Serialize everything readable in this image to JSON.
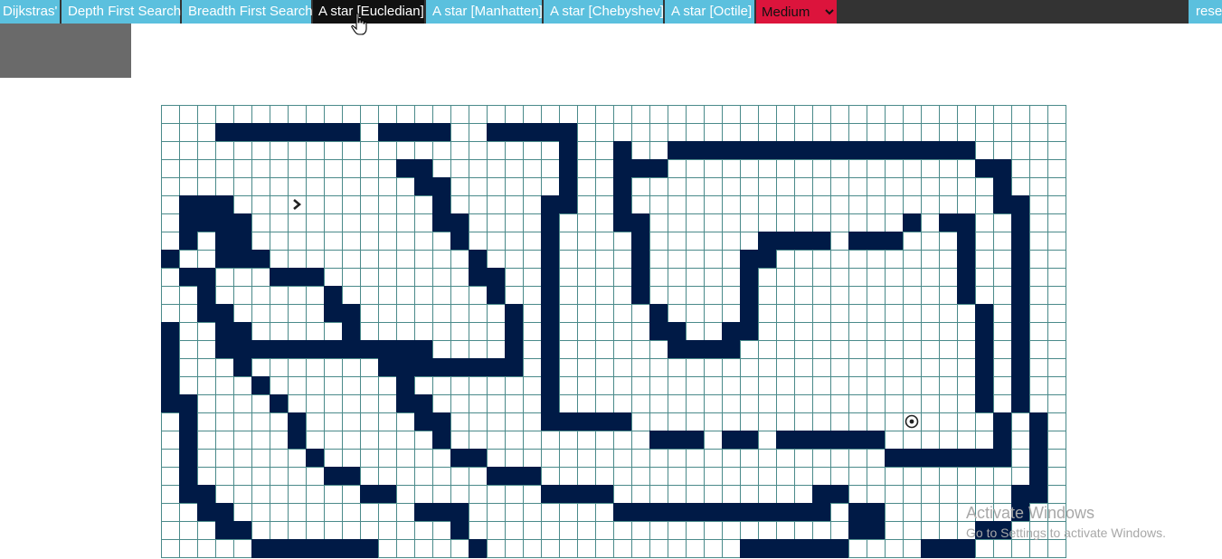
{
  "nav": {
    "buttons": [
      {
        "label": "Dijkstras'",
        "active": false
      },
      {
        "label": "Depth First Search",
        "active": false
      },
      {
        "label": "Breadth First Search",
        "active": false
      },
      {
        "label": "A star [Eucledian]",
        "active": true
      },
      {
        "label": "A star [Manhatten]",
        "active": false
      },
      {
        "label": "A star [Chebyshev]",
        "active": false
      },
      {
        "label": "A star [Octile]",
        "active": false
      }
    ],
    "speed": {
      "selected": "Medium",
      "options": [
        "Medium"
      ]
    },
    "reset_label": "reset"
  },
  "colors": {
    "navbar": "#333333",
    "button": "#5bc0de",
    "active_button": "#111111",
    "select": "#dc143c",
    "wall": "#001a46",
    "grid_line": "#4a8a8a",
    "panel": "#6a6a6a"
  },
  "grid": {
    "cols": 50,
    "rows": 25,
    "start": {
      "row": 5,
      "col": 7,
      "icon": "chevron-right-icon"
    },
    "target": {
      "row": 17,
      "col": 41,
      "icon": "target-icon"
    },
    "walls": [
      [
        1,
        3
      ],
      [
        1,
        4
      ],
      [
        1,
        5
      ],
      [
        1,
        6
      ],
      [
        1,
        7
      ],
      [
        1,
        8
      ],
      [
        1,
        9
      ],
      [
        1,
        10
      ],
      [
        1,
        12
      ],
      [
        1,
        13
      ],
      [
        1,
        14
      ],
      [
        1,
        15
      ],
      [
        1,
        18
      ],
      [
        1,
        19
      ],
      [
        1,
        20
      ],
      [
        1,
        21
      ],
      [
        1,
        22
      ],
      [
        2,
        22
      ],
      [
        2,
        25
      ],
      [
        2,
        28
      ],
      [
        2,
        29
      ],
      [
        2,
        30
      ],
      [
        2,
        31
      ],
      [
        2,
        32
      ],
      [
        2,
        33
      ],
      [
        2,
        34
      ],
      [
        2,
        35
      ],
      [
        2,
        36
      ],
      [
        2,
        37
      ],
      [
        2,
        38
      ],
      [
        2,
        39
      ],
      [
        2,
        40
      ],
      [
        2,
        41
      ],
      [
        2,
        42
      ],
      [
        2,
        43
      ],
      [
        2,
        44
      ],
      [
        3,
        13
      ],
      [
        3,
        14
      ],
      [
        3,
        22
      ],
      [
        3,
        25
      ],
      [
        3,
        26
      ],
      [
        3,
        27
      ],
      [
        3,
        45
      ],
      [
        3,
        46
      ],
      [
        4,
        14
      ],
      [
        4,
        15
      ],
      [
        4,
        22
      ],
      [
        4,
        25
      ],
      [
        4,
        46
      ],
      [
        5,
        1
      ],
      [
        5,
        2
      ],
      [
        5,
        3
      ],
      [
        5,
        15
      ],
      [
        5,
        21
      ],
      [
        5,
        22
      ],
      [
        5,
        25
      ],
      [
        5,
        46
      ],
      [
        5,
        47
      ],
      [
        6,
        1
      ],
      [
        6,
        2
      ],
      [
        6,
        3
      ],
      [
        6,
        4
      ],
      [
        6,
        15
      ],
      [
        6,
        16
      ],
      [
        6,
        21
      ],
      [
        6,
        25
      ],
      [
        6,
        26
      ],
      [
        6,
        41
      ],
      [
        6,
        43
      ],
      [
        6,
        44
      ],
      [
        6,
        47
      ],
      [
        7,
        1
      ],
      [
        7,
        3
      ],
      [
        7,
        4
      ],
      [
        7,
        16
      ],
      [
        7,
        21
      ],
      [
        7,
        26
      ],
      [
        7,
        33
      ],
      [
        7,
        34
      ],
      [
        7,
        35
      ],
      [
        7,
        36
      ],
      [
        7,
        38
      ],
      [
        7,
        39
      ],
      [
        7,
        40
      ],
      [
        7,
        44
      ],
      [
        7,
        47
      ],
      [
        8,
        0
      ],
      [
        8,
        3
      ],
      [
        8,
        4
      ],
      [
        8,
        5
      ],
      [
        8,
        17
      ],
      [
        8,
        21
      ],
      [
        8,
        26
      ],
      [
        8,
        32
      ],
      [
        8,
        33
      ],
      [
        8,
        44
      ],
      [
        8,
        47
      ],
      [
        9,
        1
      ],
      [
        9,
        2
      ],
      [
        9,
        6
      ],
      [
        9,
        7
      ],
      [
        9,
        8
      ],
      [
        9,
        17
      ],
      [
        9,
        18
      ],
      [
        9,
        21
      ],
      [
        9,
        26
      ],
      [
        9,
        32
      ],
      [
        9,
        44
      ],
      [
        9,
        47
      ],
      [
        10,
        2
      ],
      [
        10,
        9
      ],
      [
        10,
        18
      ],
      [
        10,
        21
      ],
      [
        10,
        26
      ],
      [
        10,
        32
      ],
      [
        10,
        44
      ],
      [
        10,
        47
      ],
      [
        11,
        2
      ],
      [
        11,
        3
      ],
      [
        11,
        9
      ],
      [
        11,
        10
      ],
      [
        11,
        19
      ],
      [
        11,
        21
      ],
      [
        11,
        27
      ],
      [
        11,
        32
      ],
      [
        11,
        45
      ],
      [
        11,
        47
      ],
      [
        12,
        0
      ],
      [
        12,
        3
      ],
      [
        12,
        4
      ],
      [
        12,
        10
      ],
      [
        12,
        19
      ],
      [
        12,
        21
      ],
      [
        12,
        27
      ],
      [
        12,
        28
      ],
      [
        12,
        31
      ],
      [
        12,
        32
      ],
      [
        12,
        45
      ],
      [
        12,
        47
      ],
      [
        13,
        0
      ],
      [
        13,
        3
      ],
      [
        13,
        4
      ],
      [
        13,
        5
      ],
      [
        13,
        6
      ],
      [
        13,
        7
      ],
      [
        13,
        8
      ],
      [
        13,
        9
      ],
      [
        13,
        10
      ],
      [
        13,
        11
      ],
      [
        13,
        12
      ],
      [
        13,
        13
      ],
      [
        13,
        14
      ],
      [
        13,
        19
      ],
      [
        13,
        21
      ],
      [
        13,
        28
      ],
      [
        13,
        29
      ],
      [
        13,
        30
      ],
      [
        13,
        31
      ],
      [
        13,
        45
      ],
      [
        13,
        47
      ],
      [
        14,
        0
      ],
      [
        14,
        4
      ],
      [
        14,
        12
      ],
      [
        14,
        13
      ],
      [
        14,
        14
      ],
      [
        14,
        15
      ],
      [
        14,
        16
      ],
      [
        14,
        17
      ],
      [
        14,
        18
      ],
      [
        14,
        19
      ],
      [
        14,
        21
      ],
      [
        14,
        45
      ],
      [
        14,
        47
      ],
      [
        15,
        0
      ],
      [
        15,
        5
      ],
      [
        15,
        13
      ],
      [
        15,
        21
      ],
      [
        15,
        45
      ],
      [
        15,
        47
      ],
      [
        16,
        0
      ],
      [
        16,
        1
      ],
      [
        16,
        6
      ],
      [
        16,
        13
      ],
      [
        16,
        14
      ],
      [
        16,
        21
      ],
      [
        16,
        45
      ],
      [
        16,
        47
      ],
      [
        17,
        1
      ],
      [
        17,
        7
      ],
      [
        17,
        14
      ],
      [
        17,
        15
      ],
      [
        17,
        21
      ],
      [
        17,
        22
      ],
      [
        17,
        23
      ],
      [
        17,
        24
      ],
      [
        17,
        25
      ],
      [
        17,
        46
      ],
      [
        17,
        48
      ],
      [
        18,
        1
      ],
      [
        18,
        7
      ],
      [
        18,
        15
      ],
      [
        18,
        27
      ],
      [
        18,
        28
      ],
      [
        18,
        29
      ],
      [
        18,
        31
      ],
      [
        18,
        32
      ],
      [
        18,
        34
      ],
      [
        18,
        35
      ],
      [
        18,
        36
      ],
      [
        18,
        37
      ],
      [
        18,
        38
      ],
      [
        18,
        39
      ],
      [
        18,
        46
      ],
      [
        18,
        48
      ],
      [
        19,
        1
      ],
      [
        19,
        8
      ],
      [
        19,
        16
      ],
      [
        19,
        17
      ],
      [
        19,
        40
      ],
      [
        19,
        41
      ],
      [
        19,
        42
      ],
      [
        19,
        43
      ],
      [
        19,
        44
      ],
      [
        19,
        45
      ],
      [
        19,
        46
      ],
      [
        19,
        48
      ],
      [
        20,
        1
      ],
      [
        20,
        9
      ],
      [
        20,
        10
      ],
      [
        20,
        18
      ],
      [
        20,
        19
      ],
      [
        20,
        20
      ],
      [
        20,
        48
      ],
      [
        21,
        1
      ],
      [
        21,
        2
      ],
      [
        21,
        11
      ],
      [
        21,
        12
      ],
      [
        21,
        21
      ],
      [
        21,
        22
      ],
      [
        21,
        23
      ],
      [
        21,
        24
      ],
      [
        21,
        36
      ],
      [
        21,
        37
      ],
      [
        21,
        47
      ],
      [
        21,
        48
      ],
      [
        22,
        2
      ],
      [
        22,
        3
      ],
      [
        22,
        14
      ],
      [
        22,
        15
      ],
      [
        22,
        16
      ],
      [
        22,
        25
      ],
      [
        22,
        26
      ],
      [
        22,
        27
      ],
      [
        22,
        28
      ],
      [
        22,
        29
      ],
      [
        22,
        30
      ],
      [
        22,
        31
      ],
      [
        22,
        32
      ],
      [
        22,
        33
      ],
      [
        22,
        34
      ],
      [
        22,
        35
      ],
      [
        22,
        36
      ],
      [
        22,
        38
      ],
      [
        22,
        39
      ],
      [
        22,
        47
      ],
      [
        23,
        3
      ],
      [
        23,
        4
      ],
      [
        23,
        16
      ],
      [
        23,
        38
      ],
      [
        23,
        39
      ],
      [
        23,
        45
      ],
      [
        23,
        46
      ],
      [
        24,
        5
      ],
      [
        24,
        6
      ],
      [
        24,
        7
      ],
      [
        24,
        8
      ],
      [
        24,
        9
      ],
      [
        24,
        10
      ],
      [
        24,
        11
      ],
      [
        24,
        17
      ],
      [
        24,
        32
      ],
      [
        24,
        33
      ],
      [
        24,
        34
      ],
      [
        24,
        35
      ],
      [
        24,
        36
      ],
      [
        24,
        37
      ],
      [
        24,
        42
      ],
      [
        24,
        43
      ],
      [
        24,
        44
      ]
    ]
  },
  "watermark": {
    "title": "Activate Windows",
    "subtitle": "Go to Settings to activate Windows."
  }
}
